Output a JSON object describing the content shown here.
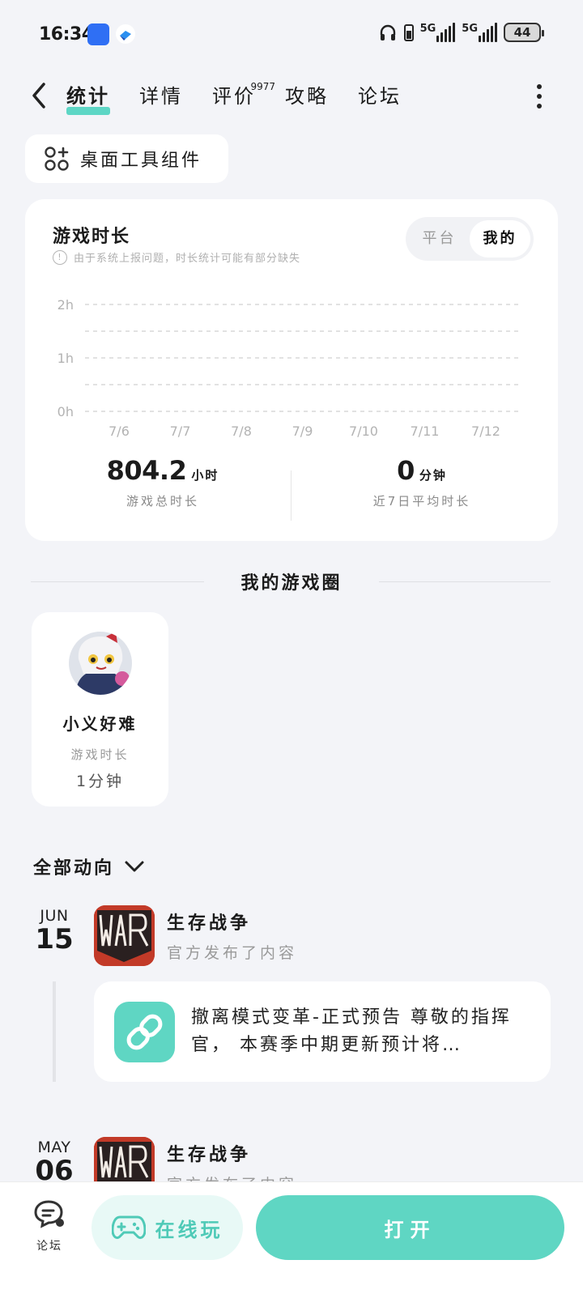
{
  "status_bar": {
    "time": "16:34",
    "network_1": "5G",
    "network_2": "5G",
    "battery": "44",
    "icons": [
      "honor-app-icon",
      "feather-app-icon",
      "headphones-icon",
      "battery-small-icon",
      "signal-icon",
      "signal-icon"
    ]
  },
  "nav": {
    "tabs": [
      {
        "label": "统计",
        "active": true
      },
      {
        "label": "详情",
        "active": false
      },
      {
        "label": "评价",
        "active": false,
        "badge": "9977"
      },
      {
        "label": "攻略",
        "active": false
      },
      {
        "label": "论坛",
        "active": false
      }
    ]
  },
  "widget_button": {
    "label": "桌面工具组件",
    "icon": "widget-grid-icon"
  },
  "stats_card": {
    "title": "游戏时长",
    "note": "由于系统上报问题，时长统计可能有部分缺失",
    "segment": [
      "平台",
      "我的"
    ],
    "segment_selected": "我的",
    "total_value": "804.2",
    "total_unit": "小时",
    "total_label": "游戏总时长",
    "avg_value": "0",
    "avg_unit": "分钟",
    "avg_label": "近7日平均时长"
  },
  "chart_data": {
    "type": "bar",
    "categories": [
      "7/6",
      "7/7",
      "7/8",
      "7/9",
      "7/10",
      "7/11",
      "7/12"
    ],
    "values": [
      0,
      0,
      0,
      0,
      0,
      0,
      0
    ],
    "y_ticks": [
      "2h",
      "1h",
      "0h"
    ],
    "ylim": [
      0,
      2
    ],
    "grid": true
  },
  "circle_section": {
    "title": "我的游戏圈"
  },
  "player": {
    "name": "小义好难",
    "sub_label": "游戏时长",
    "time": "1分钟"
  },
  "feed": {
    "filter_label": "全部动向",
    "items": [
      {
        "month": "JUN",
        "day": "15",
        "game": "生存战争",
        "action": "官方发布了内容",
        "post": "撤离模式变革-正式预告 尊敬的指挥官， 本赛季中期更新预计将…"
      },
      {
        "month": "MAY",
        "day": "06",
        "game": "生存战争",
        "action": "官方发布了内容"
      }
    ]
  },
  "bottom_bar": {
    "forum_label": "论坛",
    "online_label": "在线玩",
    "open_label": "打开"
  },
  "colors": {
    "accent": "#5fd6c3",
    "background": "#f3f4f8"
  }
}
